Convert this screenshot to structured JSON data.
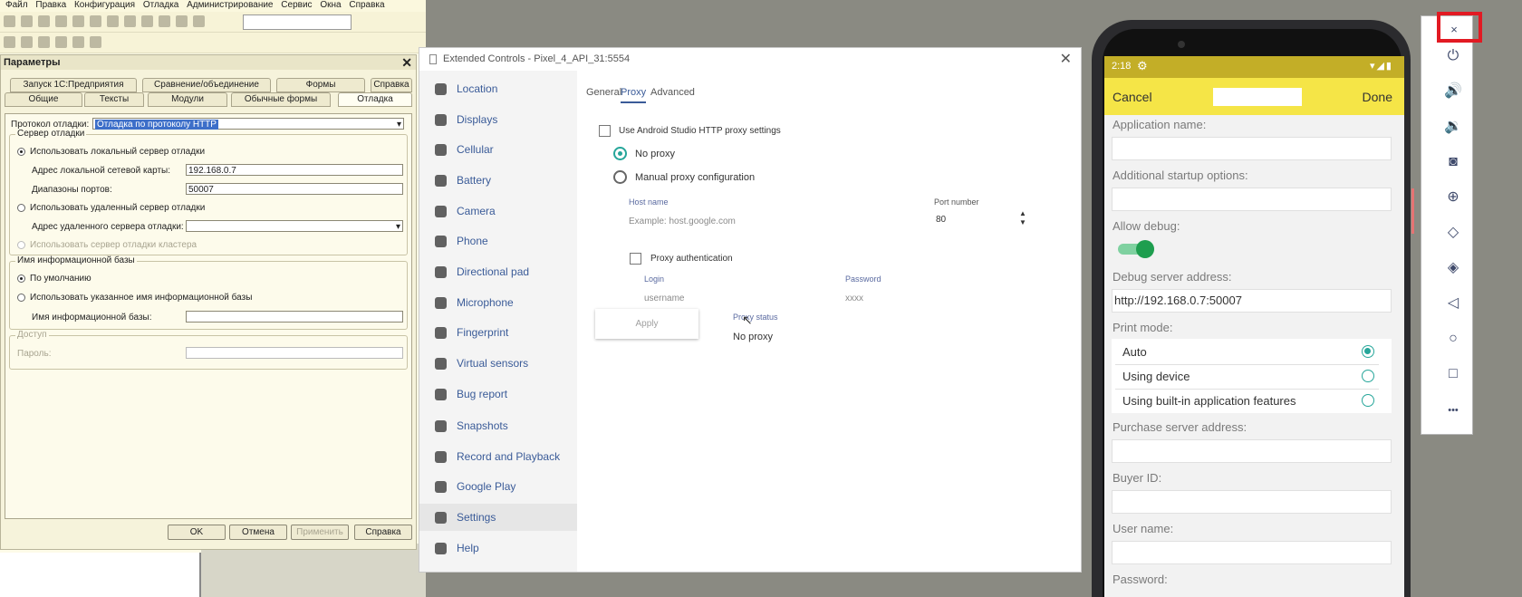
{
  "c1": {
    "menu": [
      "Файл",
      "Правка",
      "Конфигурация",
      "Отладка",
      "Администрирование",
      "Сервис",
      "Окна",
      "Справка"
    ],
    "params": {
      "title": "Параметры",
      "tabs_row1": [
        "Запуск 1С:Предприятия",
        "Сравнение/объединение",
        "Формы",
        "Справка"
      ],
      "tabs_row2": [
        "Общие",
        "Тексты",
        "Модули",
        "Обычные формы",
        "Отладка"
      ],
      "debug_protocol_label": "Протокол отладки:",
      "debug_protocol_value": "Отладка по протоколу HTTP",
      "group_server": "Сервер отладки",
      "use_local_server": "Использовать локальный сервер отладки",
      "local_nic_label": "Адрес локальной сетевой карты:",
      "local_nic_value": "192.168.0.7",
      "port_range_label": "Диапазоны портов:",
      "port_range_value": "50007",
      "use_remote_server": "Использовать удаленный сервер отладки",
      "remote_addr_label": "Адрес удаленного сервера отладки:",
      "use_cluster_server": "Использовать сервер отладки кластера",
      "group_ib": "Имя информационной базы",
      "ib_default": "По умолчанию",
      "ib_use_specified": "Использовать указанное имя информационной базы",
      "ib_name_label": "Имя информационной базы:",
      "group_access": "Доступ",
      "password_label": "Пароль:",
      "ok": "OK",
      "cancel": "Отмена",
      "apply": "Применить",
      "help": "Справка"
    }
  },
  "ext": {
    "title": "Extended Controls - Pixel_4_API_31:5554",
    "nav": [
      "Location",
      "Displays",
      "Cellular",
      "Battery",
      "Camera",
      "Phone",
      "Directional pad",
      "Microphone",
      "Fingerprint",
      "Virtual sensors",
      "Bug report",
      "Snapshots",
      "Record and Playback",
      "Google Play",
      "Settings",
      "Help"
    ],
    "tabs": [
      "General",
      "Proxy",
      "Advanced"
    ],
    "use_studio_proxy": "Use Android Studio HTTP proxy settings",
    "no_proxy": "No proxy",
    "manual_proxy": "Manual proxy configuration",
    "host_name_label": "Host name",
    "host_placeholder": "Example: host.google.com",
    "port_label": "Port number",
    "port_value": "80",
    "proxy_auth": "Proxy authentication",
    "login_label": "Login",
    "login_placeholder": "username",
    "password_label": "Password",
    "password_placeholder": "xxxx",
    "apply": "Apply",
    "proxy_status_label": "Proxy status",
    "proxy_status_value": "No proxy"
  },
  "phone": {
    "time": "2:18",
    "cancel": "Cancel",
    "done": "Done",
    "app_name_label": "Application name:",
    "startup_options_label": "Additional startup options:",
    "allow_debug_label": "Allow debug:",
    "allow_debug_on": true,
    "debug_server_label": "Debug server address:",
    "debug_server_value": "http://192.168.0.7:50007",
    "print_mode_label": "Print mode:",
    "print_modes": [
      "Auto",
      "Using device",
      "Using built-in application features"
    ],
    "print_mode_selected": 0,
    "purchase_server_label": "Purchase server address:",
    "buyer_id_label": "Buyer ID:",
    "user_name_label": "User name:",
    "password_label": "Password:"
  },
  "emulator_toolbar": {
    "close": "×",
    "buttons": [
      "power-icon",
      "volume-up-icon",
      "volume-down-icon",
      "camera-icon",
      "zoom-icon",
      "rotate-left-icon",
      "rotate-right-icon",
      "back-icon",
      "home-icon",
      "overview-icon",
      "more-icon"
    ],
    "more": "•••",
    "accent": "#e21a23"
  }
}
